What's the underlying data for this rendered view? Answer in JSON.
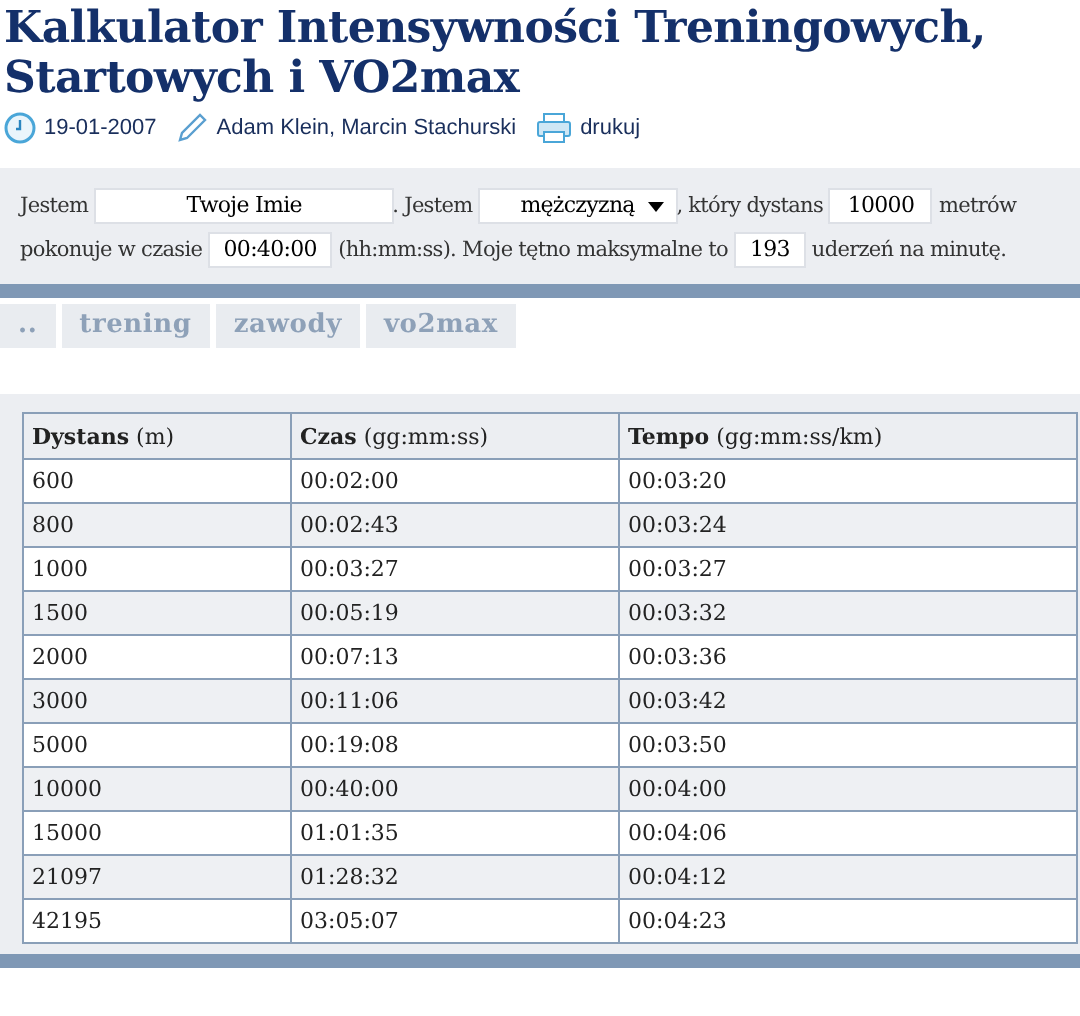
{
  "title": "Kalkulator Intensywności Treningowych, Startowych i VO2max",
  "meta": {
    "date": "19-01-2007",
    "authors": "Adam Klein, Marcin Stachurski",
    "print": "drukuj"
  },
  "form": [
    {
      "kind": "text",
      "value": "Jestem"
    },
    {
      "kind": "input",
      "value": "Twoje Imie"
    },
    {
      "kind": "text",
      "value": ". Jestem"
    },
    {
      "kind": "select",
      "value": "mężczyzną"
    },
    {
      "kind": "text",
      "value": ", który dystans"
    },
    {
      "kind": "input",
      "value": "10000"
    },
    {
      "kind": "text",
      "value": "metrów"
    },
    {
      "kind": "text",
      "value": "pokonuje w czasie"
    },
    {
      "kind": "input",
      "value": "00:40:00"
    },
    {
      "kind": "text",
      "value": "(hh:mm:ss). Moje tętno maksymalne to"
    },
    {
      "kind": "input",
      "value": "193"
    },
    {
      "kind": "text",
      "value": "uderzeń na minutę."
    }
  ],
  "tabs": [
    "..",
    "trening",
    "zawody",
    "vo2max"
  ],
  "table": {
    "columns": [
      "**Dystans** (m)",
      "**Czas** (gg:mm:ss)",
      "**Tempo** (gg:mm:ss/km)"
    ],
    "rows": [
      [
        "600",
        "00:02:00",
        "00:03:20"
      ],
      [
        "800",
        "00:02:43",
        "00:03:24"
      ],
      [
        "1000",
        "00:03:27",
        "00:03:27"
      ],
      [
        "1500",
        "00:05:19",
        "00:03:32"
      ],
      [
        "2000",
        "00:07:13",
        "00:03:36"
      ],
      [
        "3000",
        "00:11:06",
        "00:03:42"
      ],
      [
        "5000",
        "00:19:08",
        "00:03:50"
      ],
      [
        "10000",
        "00:40:00",
        "00:04:00"
      ],
      [
        "15000",
        "01:01:35",
        "00:04:06"
      ],
      [
        "21097",
        "01:28:32",
        "00:04:12"
      ],
      [
        "42195",
        "03:05:07",
        "00:04:23"
      ]
    ]
  }
}
